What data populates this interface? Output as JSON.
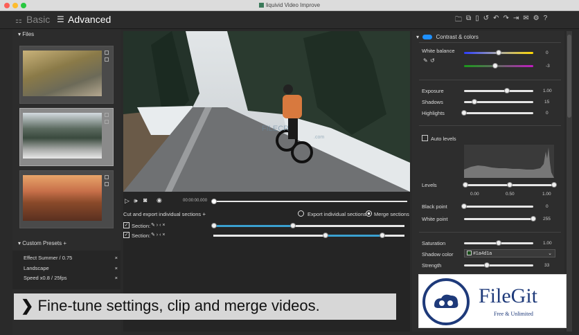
{
  "window": {
    "title": "liquivid Video Improve"
  },
  "toolbar": {
    "basic_label": "Basic",
    "advanced_label": "Advanced"
  },
  "files": {
    "header": "Files"
  },
  "presets": {
    "header": "Custom Presets",
    "items": [
      "Effect Summer / 0.75",
      "Landscape",
      "Speed x0.8 / 25fps"
    ]
  },
  "playback": {
    "time": "00:00:00.000"
  },
  "sections": {
    "cut_export_label": "Cut and export individual sections",
    "export_individual_label": "Export individual sections",
    "merge_sections_label": "Merge sections",
    "section_label": "Section:"
  },
  "watermark": {
    "text": "FILECR",
    "sub": ".com"
  },
  "adjust": {
    "header": "Contrast & colors",
    "white_balance_label": "White balance",
    "wb1_value": "0",
    "wb2_value": "-3",
    "exposure_label": "Exposure",
    "exposure_value": "1.00",
    "shadows_label": "Shadows",
    "shadows_value": "15",
    "highlights_label": "Highlights",
    "highlights_value": "0",
    "auto_levels_label": "Auto levels",
    "levels_label": "Levels",
    "levels_ticks": [
      "0.00",
      "0.50",
      "1.00"
    ],
    "black_point_label": "Black point",
    "black_point_value": "0",
    "white_point_label": "White point",
    "white_point_value": "255",
    "saturation_label": "Saturation",
    "saturation_value": "1.00",
    "shadow_color_label": "Shadow color",
    "shadow_color_value": "#1a4d1a",
    "strength_label": "Strength",
    "strength_value": "33"
  },
  "caption": {
    "text": "Fine-tune settings, clip and merge videos."
  },
  "logo": {
    "name": "FileGit",
    "tagline": "Free & Unlimited"
  },
  "colors": {
    "accent": "#3aa0d0",
    "toggle": "#1e90ff",
    "shadow_swatch": "#1a4d1a"
  }
}
